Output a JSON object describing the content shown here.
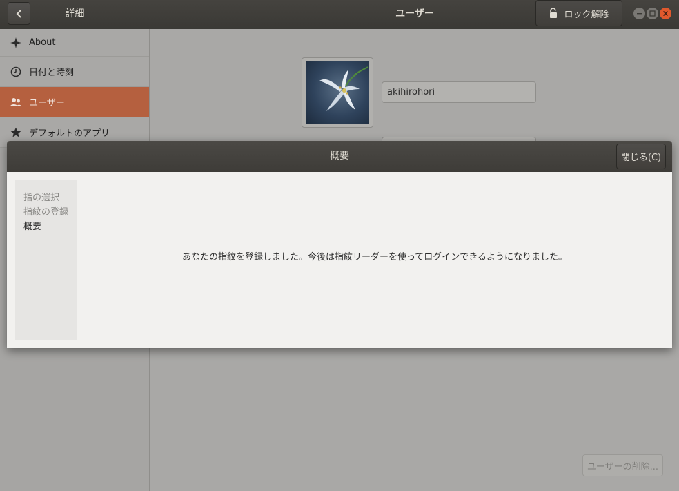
{
  "titlebar": {
    "left_title": "詳細",
    "center_title": "ユーザー",
    "unlock_label": "ロック解除"
  },
  "sidebar": {
    "items": [
      {
        "label": "About",
        "icon": "sparkle-icon"
      },
      {
        "label": "日付と時刻",
        "icon": "clock-icon"
      },
      {
        "label": "ユーザー",
        "icon": "users-icon",
        "selected": true
      },
      {
        "label": "デフォルトのアプリ",
        "icon": "star-icon"
      }
    ]
  },
  "user": {
    "username": "akihirohori",
    "remove_label": "ユーザーの削除..."
  },
  "dialog": {
    "title": "概要",
    "close_label": "閉じる(C)",
    "steps": [
      "指の選択",
      "指紋の登録",
      "概要"
    ],
    "current_step": 2,
    "message": "あなたの指紋を登録しました。今後は指紋リーダーを使ってログインできるようになりました。"
  },
  "colors": {
    "accent": "#b5603f",
    "titlebar": "#3a3935",
    "close_button": "#e0592d"
  }
}
